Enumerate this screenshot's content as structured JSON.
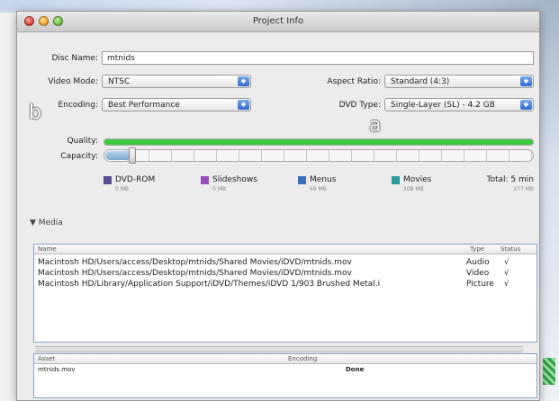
{
  "window": {
    "title": "Project Info"
  },
  "form": {
    "disc_name_label": "Disc Name:",
    "disc_name_value": "mtnids",
    "video_mode_label": "Video Mode:",
    "video_mode_value": "NTSC",
    "aspect_ratio_label": "Aspect Ratio:",
    "aspect_ratio_value": "Standard (4:3)",
    "encoding_label": "Encoding:",
    "encoding_value": "Best Performance",
    "dvd_type_label": "DVD Type:",
    "dvd_type_value": "Single-Layer (SL) - 4.2 GB",
    "quality_label": "Quality:",
    "capacity_label": "Capacity:",
    "quality_level": 1.0,
    "capacity_level": 0.06
  },
  "legend": [
    {
      "name": "DVD-ROM",
      "size": "0 MB",
      "color": "#5b4e8e"
    },
    {
      "name": "Slideshows",
      "size": "0 MB",
      "color": "#9a4fb8"
    },
    {
      "name": "Menus",
      "size": "69 MB",
      "color": "#3b6fb8"
    },
    {
      "name": "Movies",
      "size": "208 MB",
      "color": "#2a9a9a"
    }
  ],
  "total": {
    "label": "Total: 5 min",
    "size": "277 MB"
  },
  "media": {
    "section_label": "▼ Media",
    "columns": {
      "name": "Name",
      "type": "Type",
      "status": "Status"
    },
    "rows": [
      {
        "name": "Macintosh HD/Users/access/Desktop/mtnids/Shared Movies/iDVD/mtnids.mov",
        "type": "Audio",
        "status": "√"
      },
      {
        "name": "Macintosh HD/Users/access/Desktop/mtnids/Shared Movies/iDVD/mtnids.mov",
        "type": "Video",
        "status": "√"
      },
      {
        "name": "Macintosh HD/Library/Application Support/iDVD/Themes/iDVD 1/903 Brushed Metal.i",
        "type": "Picture",
        "status": "√"
      }
    ]
  },
  "assets": {
    "columns": {
      "asset": "Asset",
      "encoding": "Encoding"
    },
    "rows": [
      {
        "asset": "mtnids.mov",
        "encoding": "Done"
      }
    ]
  },
  "annotations": {
    "b": "b",
    "a": "a"
  }
}
